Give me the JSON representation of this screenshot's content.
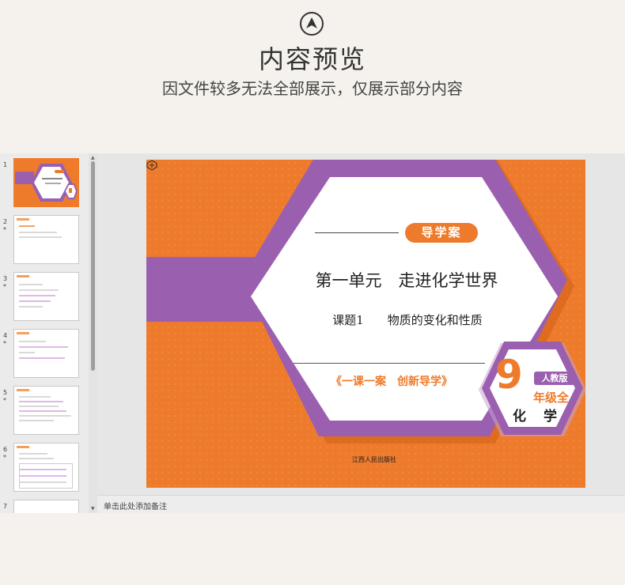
{
  "header": {
    "icon": "up-arrow-circle-icon",
    "title": "内容预览",
    "subtitle": "因文件较多无法全部展示，仅展示部分内容"
  },
  "thumbnails": [
    {
      "num": "1",
      "star": "",
      "selected": true
    },
    {
      "num": "2",
      "star": "*"
    },
    {
      "num": "3",
      "star": "*"
    },
    {
      "num": "4",
      "star": "*"
    },
    {
      "num": "5",
      "star": "*"
    },
    {
      "num": "6",
      "star": "*"
    },
    {
      "num": "7",
      "star": ""
    }
  ],
  "slide": {
    "tag": "导学案",
    "title": "第一单元　走进化学世界",
    "subtitle": "课题1　　物质的变化和性质",
    "slogan": "《一课一案　创新导学》",
    "badge": {
      "number": "9",
      "edition": "人教版",
      "grade": "年级全",
      "subject": "化 学"
    },
    "publisher": "江西人民出版社"
  },
  "notes": {
    "placeholder": "单击此处添加备注"
  },
  "colors": {
    "orange": "#ee7b2c",
    "purple": "#9b5fb0",
    "background": "#f5f2ed"
  }
}
